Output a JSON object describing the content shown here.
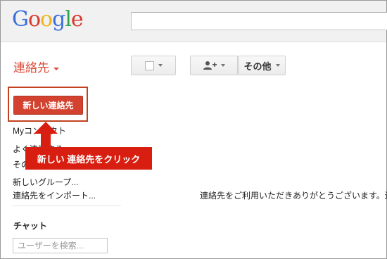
{
  "header": {
    "logo_letters": [
      "G",
      "o",
      "o",
      "g",
      "l",
      "e"
    ],
    "search": {
      "value": "",
      "placeholder": ""
    }
  },
  "app": {
    "title": "連絡先"
  },
  "toolbar": {
    "more_label": "その他"
  },
  "sidebar": {
    "new_contact_label": "新しい連絡先",
    "links": [
      "Myコンタクト",
      "よく連絡する",
      "その他",
      "新しいグループ...",
      "連絡先をインポート..."
    ],
    "chat_heading": "チャット",
    "user_search_placeholder": "ユーザーを検索..."
  },
  "main": {
    "message": "連絡先をご利用いただきありがとうございます。連"
  },
  "callout": {
    "text": "新しい 連絡先をクリック",
    "color": "#d81e10"
  },
  "colors": {
    "accent": "#dd4b39",
    "primary_button": "#d2422f"
  }
}
